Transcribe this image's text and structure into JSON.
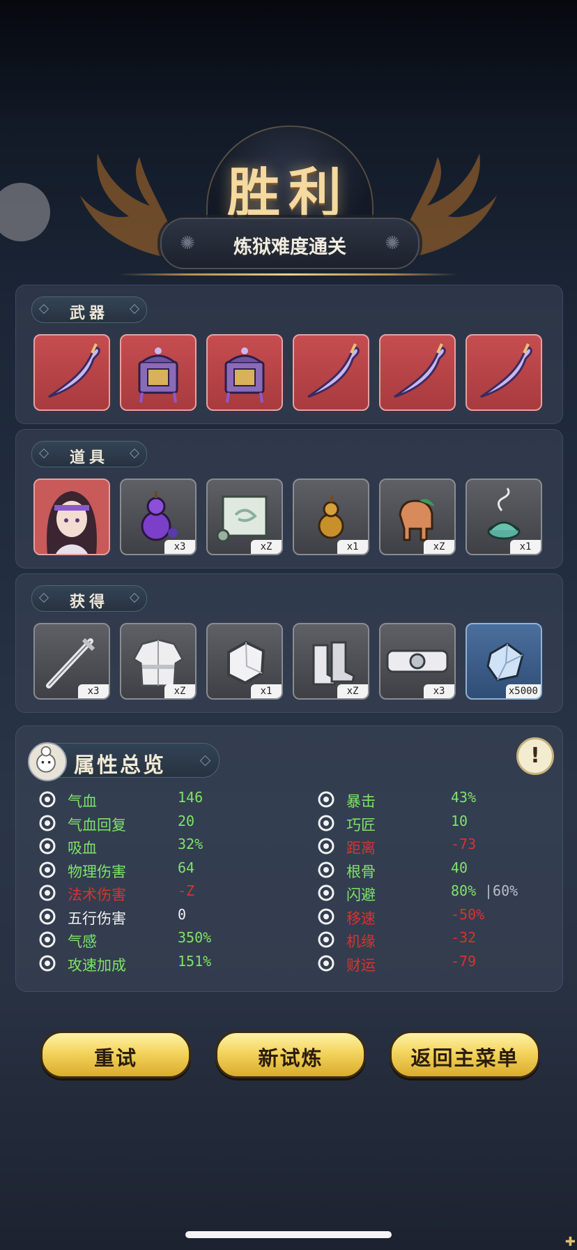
{
  "header": {
    "title": "胜利",
    "subtitle": "炼狱难度通关"
  },
  "sections": {
    "weapons": {
      "label": "武器",
      "items": [
        {
          "icon": "curved-dagger-icon",
          "style": "red",
          "qty": ""
        },
        {
          "icon": "lantern-chest-icon",
          "style": "red",
          "qty": ""
        },
        {
          "icon": "lantern-chest-icon",
          "style": "red",
          "qty": ""
        },
        {
          "icon": "curved-dagger-icon",
          "style": "red",
          "qty": ""
        },
        {
          "icon": "curved-dagger-icon",
          "style": "red",
          "qty": ""
        },
        {
          "icon": "curved-dagger-icon",
          "style": "red",
          "qty": ""
        }
      ]
    },
    "props": {
      "label": "道具",
      "items": [
        {
          "icon": "character-portrait",
          "style": "red",
          "qty": ""
        },
        {
          "icon": "purple-gourd-icon",
          "style": "gray",
          "qty": "x3"
        },
        {
          "icon": "scroll-icon",
          "style": "gray",
          "qty": "xZ"
        },
        {
          "icon": "gold-gourd-icon",
          "style": "gray",
          "qty": "x1"
        },
        {
          "icon": "horse-figurine-icon",
          "style": "gray",
          "qty": "xZ"
        },
        {
          "icon": "incense-burner-icon",
          "style": "gray",
          "qty": "x1"
        }
      ]
    },
    "rewards": {
      "label": "获得",
      "items": [
        {
          "icon": "sword-icon",
          "style": "gray",
          "qty": "x3"
        },
        {
          "icon": "robe-icon",
          "style": "gray",
          "qty": "xZ"
        },
        {
          "icon": "stone-icon",
          "style": "gray",
          "qty": "x1"
        },
        {
          "icon": "boots-icon",
          "style": "gray",
          "qty": "xZ"
        },
        {
          "icon": "belt-icon",
          "style": "gray",
          "qty": "x3"
        },
        {
          "icon": "crystal-icon",
          "style": "blue",
          "qty": "x5000"
        }
      ]
    }
  },
  "stats": {
    "title": "属性总览",
    "info_icon": "!",
    "left": [
      {
        "name": "气血",
        "value": "146",
        "name_color": "green",
        "value_color": "green",
        "icon": "heart-icon"
      },
      {
        "name": "气血回复",
        "value": "20",
        "name_color": "green",
        "value_color": "green",
        "icon": "heart-regen-icon"
      },
      {
        "name": "吸血",
        "value": "32%",
        "name_color": "green",
        "value_color": "green",
        "icon": "drop-icon"
      },
      {
        "name": "物理伤害",
        "value": "64",
        "name_color": "green",
        "value_color": "green",
        "icon": "sword-small-icon"
      },
      {
        "name": "法术伤害",
        "value": "-Z",
        "name_color": "red",
        "value_color": "red",
        "icon": "swirl-icon"
      },
      {
        "name": "五行伤害",
        "value": "0",
        "name_color": "white",
        "value_color": "white",
        "icon": "target-icon"
      },
      {
        "name": "气感",
        "value": "350%",
        "name_color": "green",
        "value_color": "green",
        "icon": "spirit-icon"
      },
      {
        "name": "攻速加成",
        "value": "151%",
        "name_color": "green",
        "value_color": "green",
        "icon": "wind-icon"
      }
    ],
    "right": [
      {
        "name": "暴击",
        "value": "43%",
        "name_color": "green",
        "value_color": "green",
        "icon": "crit-icon"
      },
      {
        "name": "巧匠",
        "value": "10",
        "name_color": "green",
        "value_color": "green",
        "icon": "hammer-icon"
      },
      {
        "name": "距离",
        "value": "-73",
        "name_color": "red",
        "value_color": "red",
        "icon": "range-icon"
      },
      {
        "name": "根骨",
        "value": "40",
        "name_color": "green",
        "value_color": "green",
        "icon": "meditate-icon"
      },
      {
        "name": "闪避",
        "value": "80%",
        "extra": "|60%",
        "name_color": "green",
        "value_color": "green",
        "icon": "dodge-icon"
      },
      {
        "name": "移速",
        "value": "-50%",
        "name_color": "red",
        "value_color": "red",
        "icon": "boot-icon"
      },
      {
        "name": "机缘",
        "value": "-32",
        "name_color": "red",
        "value_color": "red",
        "icon": "clover-icon"
      },
      {
        "name": "财运",
        "value": "-79",
        "name_color": "red",
        "value_color": "red",
        "icon": "coin-icon"
      }
    ]
  },
  "buttons": {
    "retry": "重试",
    "new_trial": "新试炼",
    "main_menu": "返回主菜单"
  },
  "colors": {
    "positive": "#7fe36a",
    "negative": "#d8332e",
    "neutral": "#f2f2f2",
    "gold": "#f3d45e"
  }
}
